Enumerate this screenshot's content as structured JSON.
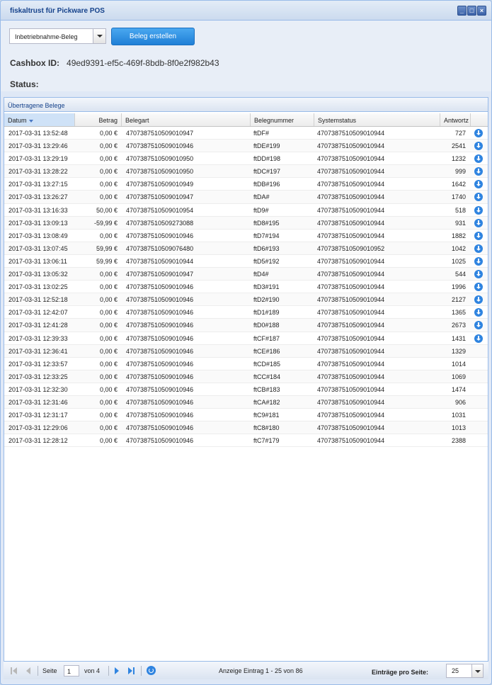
{
  "window": {
    "title": "fiskaltrust für Pickware POS"
  },
  "toolbar": {
    "receipt_type": "Inbetriebnahme-Beleg",
    "create_button": "Beleg erstellen"
  },
  "cashbox": {
    "label": "Cashbox ID:",
    "value": "49ed9391-ef5c-469f-8bdb-8f0e2f982b43"
  },
  "status": {
    "label": "Status:"
  },
  "panel": {
    "title": "Übertragene Belege"
  },
  "columns": {
    "date": "Datum",
    "amount": "Betrag",
    "type": "Belegart",
    "number": "Belegnummer",
    "system": "Systemstatus",
    "response": "Antwortz"
  },
  "rows": [
    {
      "date": "2017-03-31 13:52:48",
      "amount": "0,00 €",
      "type": "4707387510509010947",
      "number": "ftDF#",
      "system": "4707387510509010944",
      "response": "727",
      "download": true
    },
    {
      "date": "2017-03-31 13:29:46",
      "amount": "0,00 €",
      "type": "4707387510509010946",
      "number": "ftDE#199",
      "system": "4707387510509010944",
      "response": "2541",
      "download": true
    },
    {
      "date": "2017-03-31 13:29:19",
      "amount": "0,00 €",
      "type": "4707387510509010950",
      "number": "ftDD#198",
      "system": "4707387510509010944",
      "response": "1232",
      "download": true
    },
    {
      "date": "2017-03-31 13:28:22",
      "amount": "0,00 €",
      "type": "4707387510509010950",
      "number": "ftDC#197",
      "system": "4707387510509010944",
      "response": "999",
      "download": true
    },
    {
      "date": "2017-03-31 13:27:15",
      "amount": "0,00 €",
      "type": "4707387510509010949",
      "number": "ftDB#196",
      "system": "4707387510509010944",
      "response": "1642",
      "download": true
    },
    {
      "date": "2017-03-31 13:26:27",
      "amount": "0,00 €",
      "type": "4707387510509010947",
      "number": "ftDA#",
      "system": "4707387510509010944",
      "response": "1740",
      "download": true
    },
    {
      "date": "2017-03-31 13:16:33",
      "amount": "50,00 €",
      "type": "4707387510509010954",
      "number": "ftD9#",
      "system": "4707387510509010944",
      "response": "518",
      "download": true
    },
    {
      "date": "2017-03-31 13:09:13",
      "amount": "-59,99 €",
      "type": "4707387510509273088",
      "number": "ftD8#195",
      "system": "4707387510509010944",
      "response": "931",
      "download": true
    },
    {
      "date": "2017-03-31 13:08:49",
      "amount": "0,00 €",
      "type": "4707387510509010946",
      "number": "ftD7#194",
      "system": "4707387510509010944",
      "response": "1882",
      "download": true
    },
    {
      "date": "2017-03-31 13:07:45",
      "amount": "59,99 €",
      "type": "4707387510509076480",
      "number": "ftD6#193",
      "system": "4707387510509010952",
      "response": "1042",
      "download": true
    },
    {
      "date": "2017-03-31 13:06:11",
      "amount": "59,99 €",
      "type": "4707387510509010944",
      "number": "ftD5#192",
      "system": "4707387510509010944",
      "response": "1025",
      "download": true
    },
    {
      "date": "2017-03-31 13:05:32",
      "amount": "0,00 €",
      "type": "4707387510509010947",
      "number": "ftD4#",
      "system": "4707387510509010944",
      "response": "544",
      "download": true
    },
    {
      "date": "2017-03-31 13:02:25",
      "amount": "0,00 €",
      "type": "4707387510509010946",
      "number": "ftD3#191",
      "system": "4707387510509010944",
      "response": "1996",
      "download": true
    },
    {
      "date": "2017-03-31 12:52:18",
      "amount": "0,00 €",
      "type": "4707387510509010946",
      "number": "ftD2#190",
      "system": "4707387510509010944",
      "response": "2127",
      "download": true
    },
    {
      "date": "2017-03-31 12:42:07",
      "amount": "0,00 €",
      "type": "4707387510509010946",
      "number": "ftD1#189",
      "system": "4707387510509010944",
      "response": "1365",
      "download": true
    },
    {
      "date": "2017-03-31 12:41:28",
      "amount": "0,00 €",
      "type": "4707387510509010946",
      "number": "ftD0#188",
      "system": "4707387510509010944",
      "response": "2673",
      "download": true
    },
    {
      "date": "2017-03-31 12:39:33",
      "amount": "0,00 €",
      "type": "4707387510509010946",
      "number": "ftCF#187",
      "system": "4707387510509010944",
      "response": "1431",
      "download": true
    },
    {
      "date": "2017-03-31 12:36:41",
      "amount": "0,00 €",
      "type": "4707387510509010946",
      "number": "ftCE#186",
      "system": "4707387510509010944",
      "response": "1329",
      "download": false
    },
    {
      "date": "2017-03-31 12:33:57",
      "amount": "0,00 €",
      "type": "4707387510509010946",
      "number": "ftCD#185",
      "system": "4707387510509010944",
      "response": "1014",
      "download": false
    },
    {
      "date": "2017-03-31 12:33:25",
      "amount": "0,00 €",
      "type": "4707387510509010946",
      "number": "ftCC#184",
      "system": "4707387510509010944",
      "response": "1069",
      "download": false
    },
    {
      "date": "2017-03-31 12:32:30",
      "amount": "0,00 €",
      "type": "4707387510509010946",
      "number": "ftCB#183",
      "system": "4707387510509010944",
      "response": "1474",
      "download": false
    },
    {
      "date": "2017-03-31 12:31:46",
      "amount": "0,00 €",
      "type": "4707387510509010946",
      "number": "ftCA#182",
      "system": "4707387510509010944",
      "response": "906",
      "download": false
    },
    {
      "date": "2017-03-31 12:31:17",
      "amount": "0,00 €",
      "type": "4707387510509010946",
      "number": "ftC9#181",
      "system": "4707387510509010944",
      "response": "1031",
      "download": false
    },
    {
      "date": "2017-03-31 12:29:06",
      "amount": "0,00 €",
      "type": "4707387510509010946",
      "number": "ftC8#180",
      "system": "4707387510509010944",
      "response": "1013",
      "download": false
    },
    {
      "date": "2017-03-31 12:28:12",
      "amount": "0,00 €",
      "type": "4707387510509010946",
      "number": "ftC7#179",
      "system": "4707387510509010944",
      "response": "2388",
      "download": false
    }
  ],
  "pager": {
    "page_label": "Seite",
    "page_value": "1",
    "of_label": "von 4",
    "display_info": "Anzeige Eintrag 1 - 25 von 86",
    "per_page_label": "Einträge pro Seite:",
    "per_page_value": "25"
  },
  "colors": {
    "accent": "#2f84e0",
    "header_text": "#15428b"
  }
}
